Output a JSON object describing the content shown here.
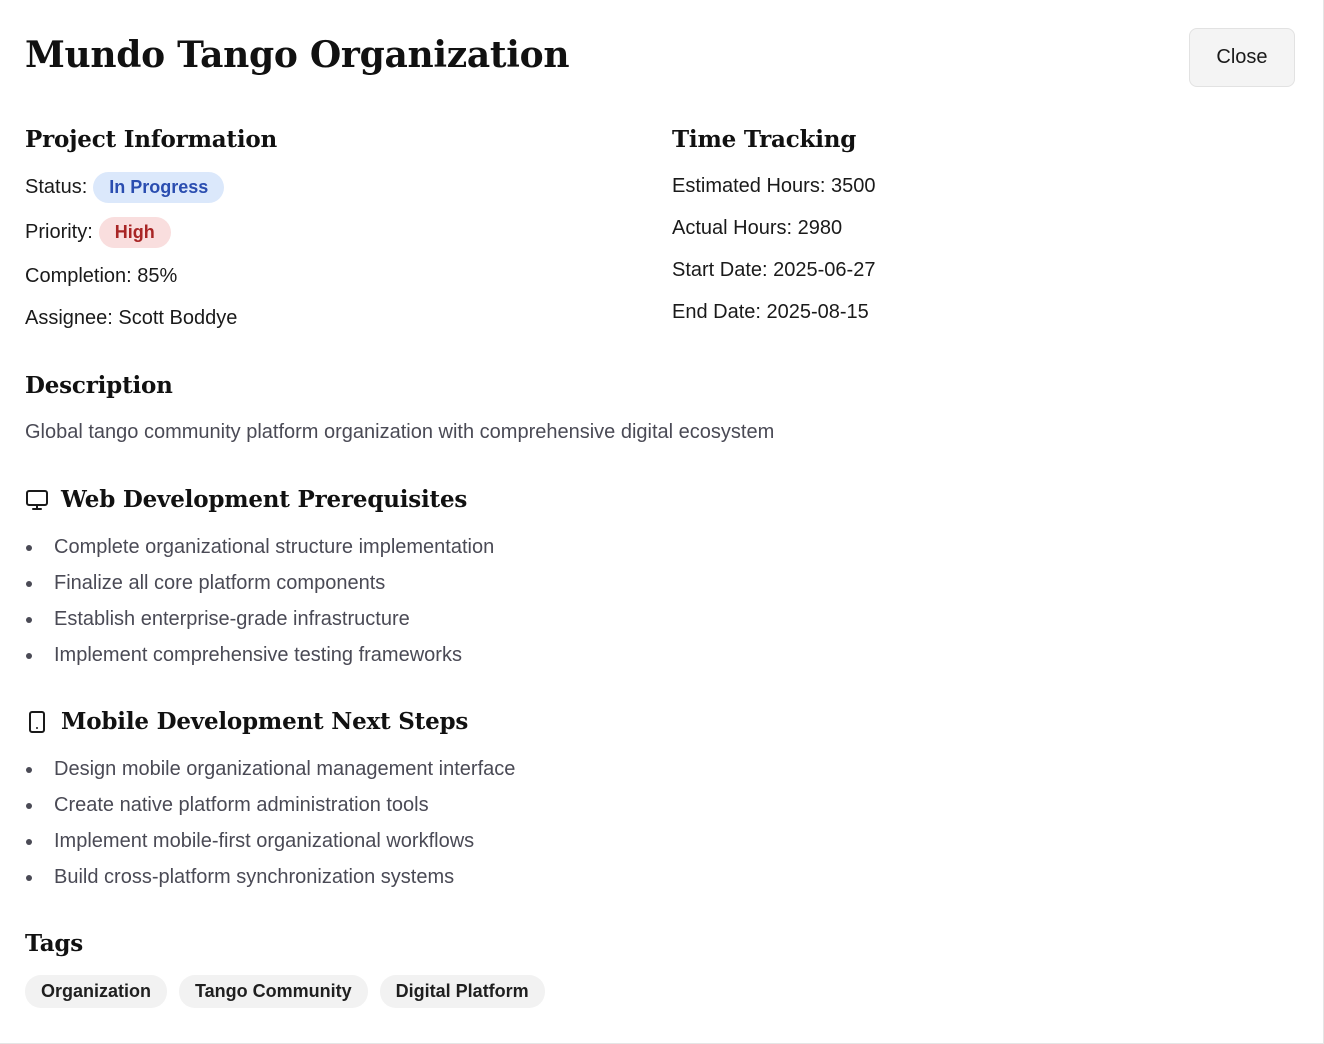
{
  "modal": {
    "title": "Mundo Tango Organization",
    "close_label": "Close"
  },
  "project_info": {
    "heading": "Project Information",
    "status_label": "Status:",
    "status_value": "In Progress",
    "priority_label": "Priority:",
    "priority_value": "High",
    "completion_text": "Completion: 85%",
    "assignee_text": "Assignee: Scott Boddye"
  },
  "time_tracking": {
    "heading": "Time Tracking",
    "estimated_text": "Estimated Hours: 3500",
    "actual_text": "Actual Hours: 2980",
    "start_text": "Start Date: 2025-06-27",
    "end_text": "End Date: 2025-08-15"
  },
  "description": {
    "heading": "Description",
    "text": "Global tango community platform organization with comprehensive digital ecosystem"
  },
  "web_prereqs": {
    "icon": "monitor-icon",
    "heading": "Web Development Prerequisites",
    "items": [
      "Complete organizational structure implementation",
      "Finalize all core platform components",
      "Establish enterprise-grade infrastructure",
      "Implement comprehensive testing frameworks"
    ]
  },
  "mobile_next": {
    "icon": "smartphone-icon",
    "heading": "Mobile Development Next Steps",
    "items": [
      "Design mobile organizational management interface",
      "Create native platform administration tools",
      "Implement mobile-first organizational workflows",
      "Build cross-platform synchronization systems"
    ]
  },
  "tags": {
    "heading": "Tags",
    "items": [
      "Organization",
      "Tango Community",
      "Digital Platform"
    ]
  },
  "colors": {
    "status_badge_bg": "#dbe8fb",
    "status_badge_text": "#2a4db0",
    "priority_badge_bg": "#f9dede",
    "priority_badge_text": "#a82525",
    "muted_text": "#4a4a55"
  }
}
